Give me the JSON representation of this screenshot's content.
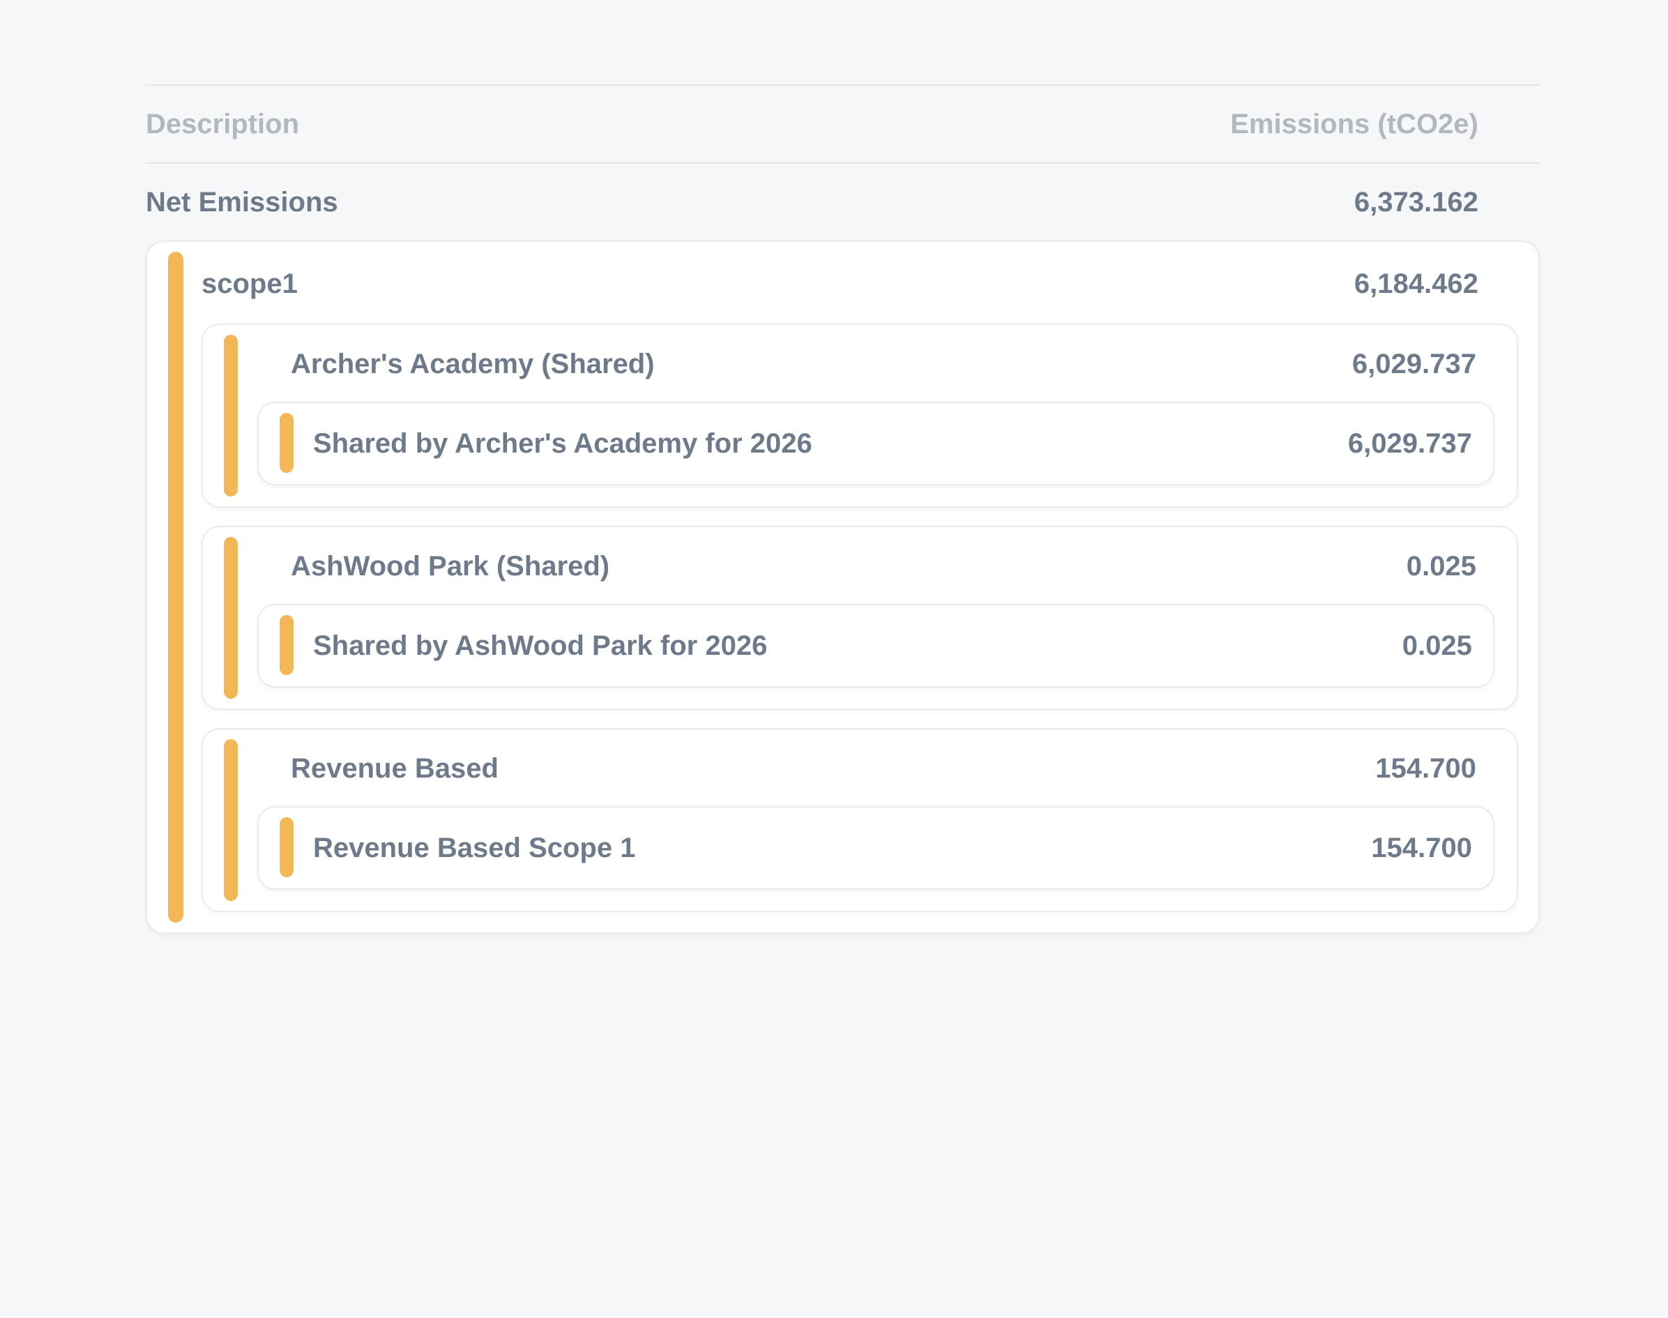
{
  "table": {
    "header": {
      "description": "Description",
      "emissions": "Emissions (tCO2e)"
    },
    "net": {
      "label": "Net Emissions",
      "value": "6,373.162"
    },
    "scope": {
      "label": "scope1",
      "value": "6,184.462",
      "groups": [
        {
          "label": "Archer's Academy (Shared)",
          "value": "6,029.737",
          "item": {
            "label": "Shared by Archer's Academy for 2026",
            "value": "6,029.737"
          }
        },
        {
          "label": "AshWood Park (Shared)",
          "value": "0.025",
          "item": {
            "label": "Shared by AshWood Park for 2026",
            "value": "0.025"
          }
        },
        {
          "label": "Revenue Based",
          "value": "154.700",
          "item": {
            "label": "Revenue Based Scope 1",
            "value": "154.700"
          }
        }
      ]
    }
  },
  "colors": {
    "accent_bar": "#f2b756",
    "text": "#6e7a8a",
    "header_text": "#b3b8bf",
    "background": "#f6f7f9"
  }
}
